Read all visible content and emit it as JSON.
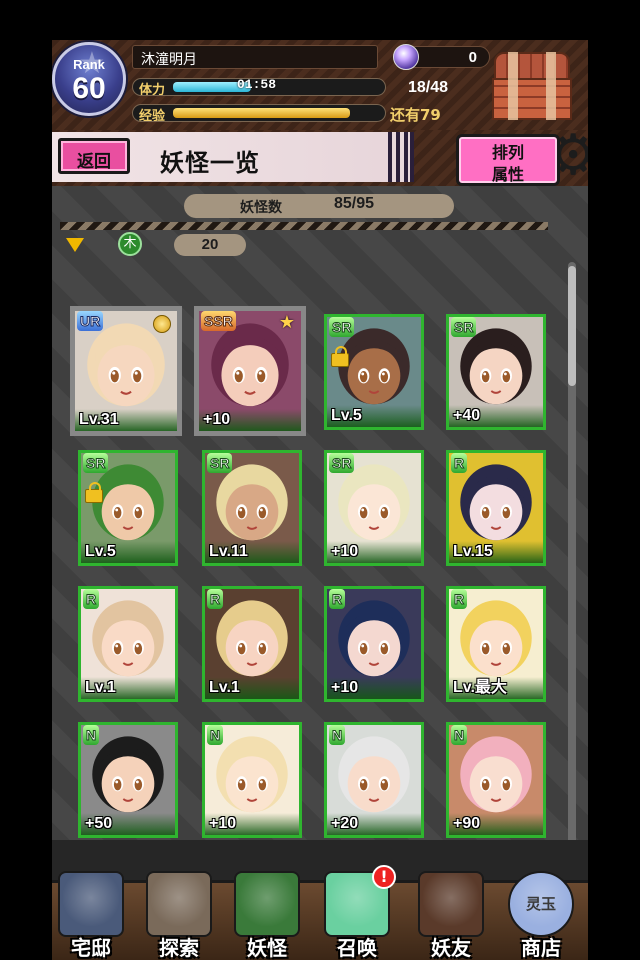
{
  "player": {
    "rank_label": "Rank",
    "rank": "60",
    "name": "沐潼明月",
    "gems": "0",
    "stamina_label": "体力",
    "stamina_timer": "01:58",
    "stamina": "18/48",
    "stamina_fraction": 0.375,
    "exp_label": "经验",
    "exp_remaining": "还有79",
    "exp_fraction": 0.85
  },
  "title_bar": {
    "back_label": "返回",
    "title": "妖怪一览",
    "sort_line1": "排列",
    "sort_line2": "属性"
  },
  "collection": {
    "count_label": "妖怪数",
    "count_value": "85/95",
    "element_label": "木",
    "filter_count": "20"
  },
  "cards": [
    {
      "rarity": "UR",
      "label": "Lv.31",
      "selected": true,
      "medal": true,
      "hair": "#f2d9b4",
      "skin": "#f6d7bf",
      "bg": "#d9d0c6"
    },
    {
      "rarity": "SSR",
      "label": "+10",
      "selected": true,
      "star": true,
      "hair": "#6a2a4a",
      "skin": "#f4cdbb",
      "bg": "#8b4a6a"
    },
    {
      "rarity": "SR",
      "label": "Lv.5",
      "lock": true,
      "hair": "#3b2a2a",
      "skin": "#a86e48",
      "bg": "#6a8a8a"
    },
    {
      "rarity": "SR",
      "label": "+40",
      "hair": "#2a1e1e",
      "skin": "#f5d5c3",
      "bg": "#c8c0b8"
    },
    {
      "rarity": "SR",
      "label": "Lv.5",
      "lock": true,
      "hair": "#3e8a34",
      "skin": "#efc9a8",
      "bg": "#7a9a6a"
    },
    {
      "rarity": "SR",
      "label": "Lv.11",
      "hair": "#e8d8a0",
      "skin": "#d8a886",
      "bg": "#7a5a4a"
    },
    {
      "rarity": "SR",
      "label": "+10",
      "hair": "#eae6c0",
      "skin": "#fbe6d6",
      "bg": "#e6e2d2"
    },
    {
      "rarity": "R",
      "label": "Lv.15",
      "hair": "#2a2a4a",
      "skin": "#f3dde0",
      "bg": "#e0c030"
    },
    {
      "rarity": "R",
      "label": "Lv.1",
      "hair": "#e2c4a0",
      "skin": "#f9dac6",
      "bg": "#efe2d8"
    },
    {
      "rarity": "R",
      "label": "Lv.1",
      "hair": "#e6cc8c",
      "skin": "#f7d4c2",
      "bg": "#5a4030"
    },
    {
      "rarity": "R",
      "label": "+10",
      "hair": "#1e2e5a",
      "skin": "#f4d8d0",
      "bg": "#3a3a5a"
    },
    {
      "rarity": "R",
      "label": "Lv.最大",
      "hair": "#f2d25e",
      "skin": "#fbe0cc",
      "bg": "#f6eed0"
    },
    {
      "rarity": "N",
      "label": "+50",
      "hair": "#1c1c1c",
      "skin": "#f5d2ba",
      "bg": "#8a8a8a"
    },
    {
      "rarity": "N",
      "label": "+10",
      "hair": "#f3dfb0",
      "skin": "#fbe4cf",
      "bg": "#f6ecd9"
    },
    {
      "rarity": "N",
      "label": "+20",
      "hair": "#e6e6e6",
      "skin": "#f8dccb",
      "bg": "#d8dcd8"
    },
    {
      "rarity": "N",
      "label": "+90",
      "hair": "#f2b0be",
      "skin": "#f9ded0",
      "bg": "#c88a6a"
    }
  ],
  "partial_cards": [
    {
      "rarity": "N",
      "medal": true
    },
    {
      "rarity": "N"
    },
    {
      "rarity": "N"
    },
    {
      "rarity": "N"
    }
  ],
  "nav": [
    {
      "label": "宅邸",
      "icon": "mansion-icon",
      "color": "#4a5a7a"
    },
    {
      "label": "探索",
      "icon": "magnifier-icon",
      "color": "#7a6a5a"
    },
    {
      "label": "妖怪",
      "icon": "yokai-scroll-icon",
      "color": "#3a7a3a"
    },
    {
      "label": "召唤",
      "icon": "summon-star-icon",
      "color": "#6ad0a0",
      "badge": "!"
    },
    {
      "label": "妖友",
      "icon": "friend-icon",
      "color": "#5a3a2a"
    },
    {
      "label": "商店",
      "icon": "shop-orb-icon",
      "color": "#9ab0e0",
      "sub": "灵玉"
    }
  ]
}
